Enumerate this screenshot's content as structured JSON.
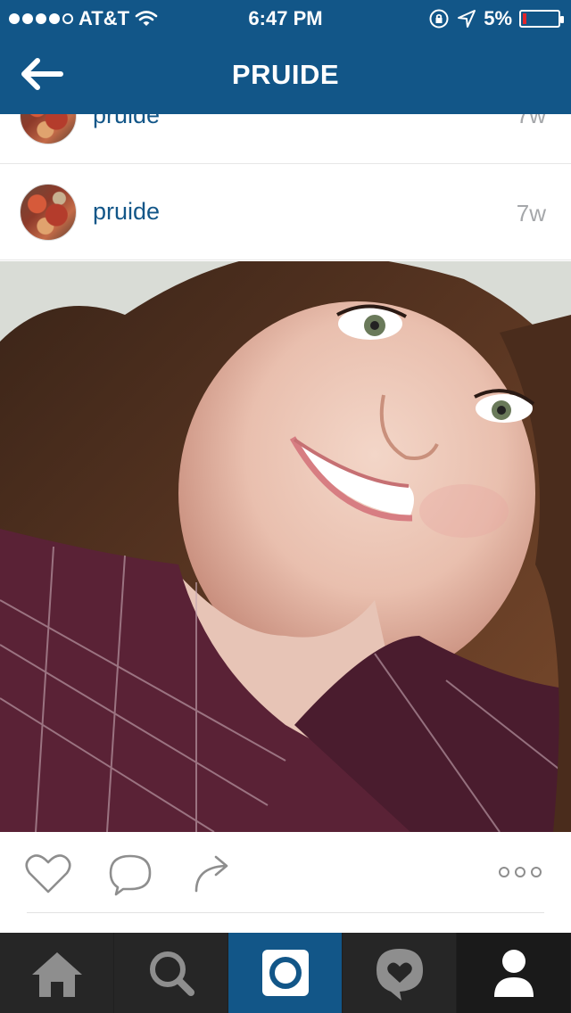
{
  "status_bar": {
    "carrier": "AT&T",
    "time": "6:47 PM",
    "battery": "5%",
    "signal_dots_filled": 4,
    "signal_dots_total": 5
  },
  "nav": {
    "title": "PRUIDE",
    "back_icon": "arrow-left-icon"
  },
  "posts": [
    {
      "username": "pruide",
      "time_ago": "7w"
    },
    {
      "username": "pruide",
      "time_ago": "7w"
    }
  ],
  "actions": {
    "like_icon": "heart-icon",
    "comment_icon": "comment-icon",
    "share_icon": "share-icon",
    "more_icon": "more-options-icon"
  },
  "tabbar": {
    "items": [
      {
        "icon": "home-icon"
      },
      {
        "icon": "search-icon"
      },
      {
        "icon": "camera-icon",
        "active": true
      },
      {
        "icon": "activity-heart-icon"
      },
      {
        "icon": "profile-icon"
      }
    ]
  },
  "colors": {
    "brand_blue": "#125688",
    "username_blue": "#125688",
    "timestamp_gray": "#a5a7aa",
    "tabbar_dark": "#262626"
  }
}
